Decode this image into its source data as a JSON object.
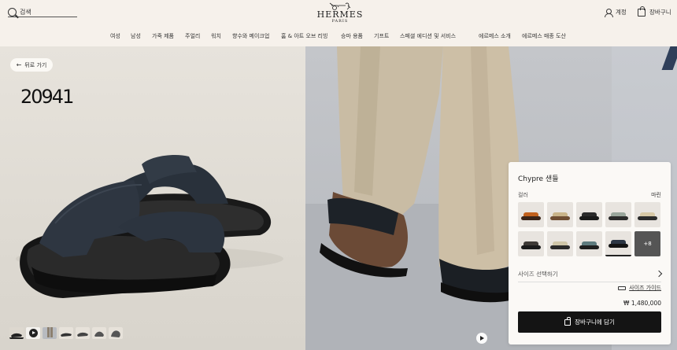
{
  "header": {
    "search_label": "검색",
    "logo_main": "HERMES",
    "logo_sub": "PARIS",
    "account_label": "계정",
    "cart_label": "장바구니"
  },
  "nav": [
    "여성",
    "남성",
    "가죽 제품",
    "주얼리",
    "워치",
    "향수와 메이크업",
    "홈 & 아트 오브 리빙",
    "승마 용품",
    "기프트",
    "스페셜 에디션 및 서비스",
    "에르메스 소개",
    "에르메스 매종 도산"
  ],
  "hero": {
    "back_label": "뒤로 가기",
    "product_number": "20941"
  },
  "product": {
    "title": "Chypre 샌들",
    "color_label": "컬러",
    "color_value": "마린",
    "swatches": [
      {
        "strap": "#c2611d",
        "sole": "#3a2418"
      },
      {
        "strap": "#c9b48a",
        "sole": "#6f4e33"
      },
      {
        "strap": "#2a2a2a",
        "sole": "#1a1a1a"
      },
      {
        "strap": "#9aa69c",
        "sole": "#2b2b2b"
      },
      {
        "strap": "#d7c8a6",
        "sole": "#2b2b2b"
      },
      {
        "strap": "#3e3a36",
        "sole": "#1b1b1b"
      },
      {
        "strap": "#cfc6a9",
        "sole": "#2a2a2a"
      },
      {
        "strap": "#5e7b7e",
        "sole": "#1f1f1f"
      },
      {
        "strap": "#2c3644",
        "sole": "#141414"
      }
    ],
    "more_label": "+8",
    "size_label": "사이즈 선택하기",
    "size_guide_label": "사이즈 가이드",
    "price": "₩ 1,480,000",
    "add_to_cart_label": "장바구니에 담기"
  },
  "colors": {
    "page_bg": "#f6f1eb",
    "button_bg": "#141414"
  }
}
